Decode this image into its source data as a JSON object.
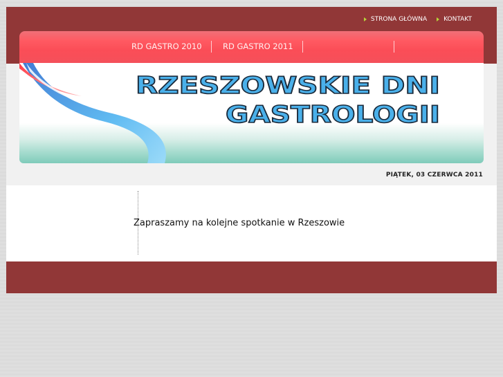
{
  "top_links": [
    {
      "label": "STRONA GŁÓWNA"
    },
    {
      "label": "KONTAKT"
    }
  ],
  "nav": {
    "items": [
      {
        "label": "RD GASTRO 2010"
      },
      {
        "label": "RD GASTRO 2011"
      }
    ]
  },
  "banner": {
    "line1": "RZESZOWSKIE DNI",
    "line2": "GASTROLOGII"
  },
  "date": "PIĄTEK, 03 CZERWCA 2011",
  "content": {
    "intro": "Zapraszamy na kolejne spotkanie w Rzeszowie"
  },
  "colors": {
    "band": "#913737",
    "nav": "#ff5a62",
    "title_fill": "#4ab0ea",
    "title_stroke": "#1b2a3a",
    "bullet": "#b6d33a"
  }
}
